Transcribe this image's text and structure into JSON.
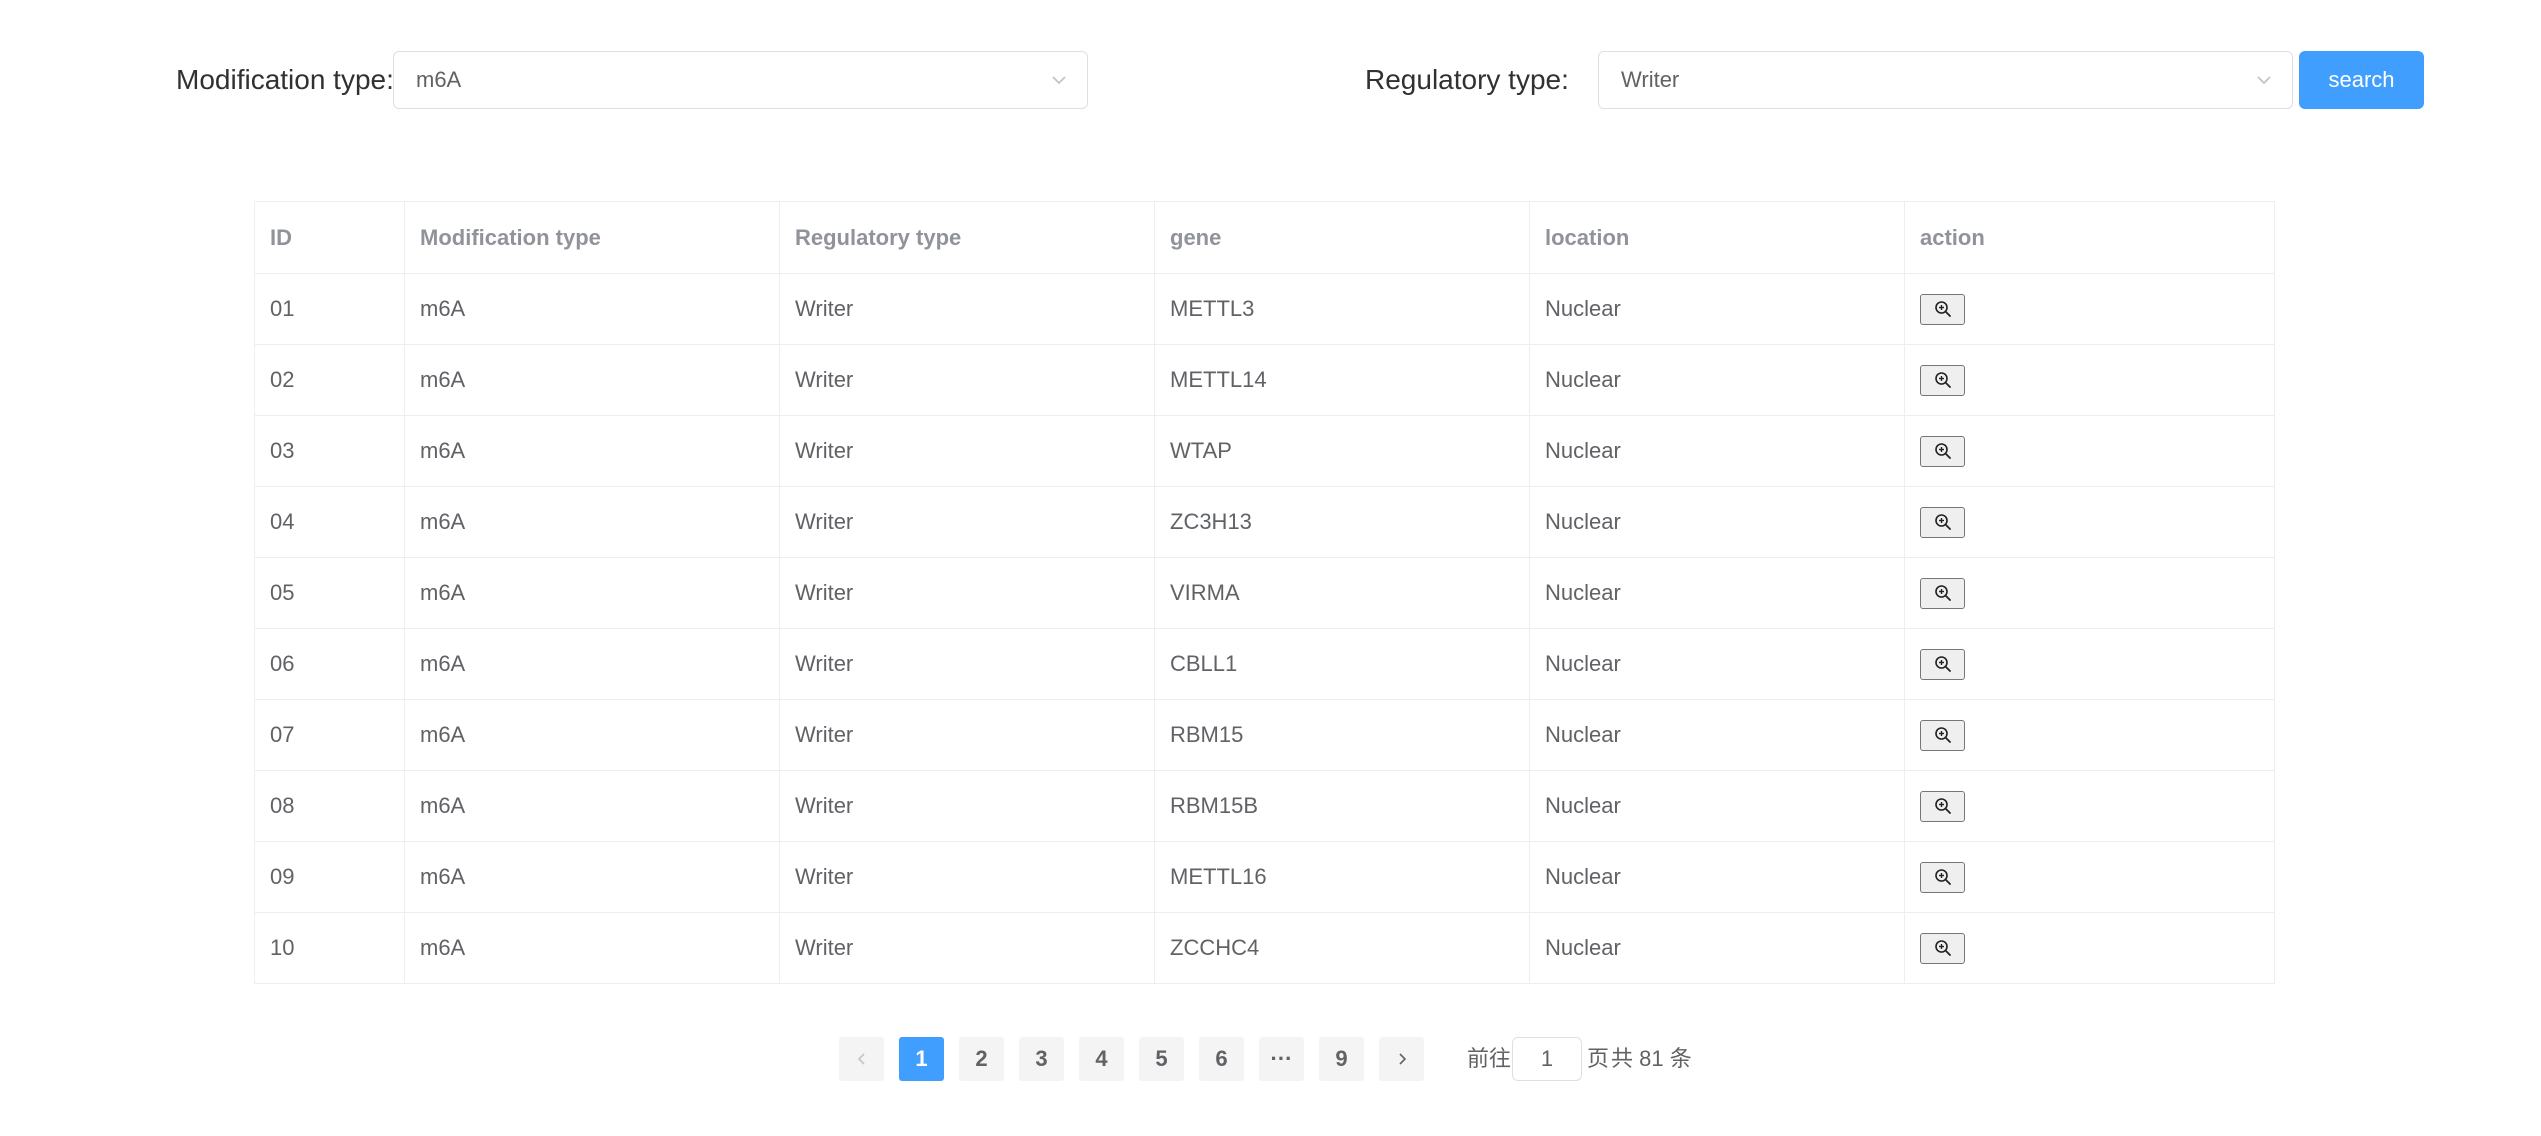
{
  "filters": {
    "modification_label": "Modification type:",
    "modification_value": "m6A",
    "regulatory_label": "Regulatory type:",
    "regulatory_value": "Writer",
    "search_label": "search"
  },
  "table": {
    "headers": [
      "ID",
      "Modification type",
      "Regulatory type",
      "gene",
      "location",
      "action"
    ],
    "rows": [
      {
        "id": "01",
        "mod": "m6A",
        "reg": "Writer",
        "gene": "METTL3",
        "location": "Nuclear"
      },
      {
        "id": "02",
        "mod": "m6A",
        "reg": "Writer",
        "gene": "METTL14",
        "location": "Nuclear"
      },
      {
        "id": "03",
        "mod": "m6A",
        "reg": "Writer",
        "gene": "WTAP",
        "location": "Nuclear"
      },
      {
        "id": "04",
        "mod": "m6A",
        "reg": "Writer",
        "gene": "ZC3H13",
        "location": "Nuclear"
      },
      {
        "id": "05",
        "mod": "m6A",
        "reg": "Writer",
        "gene": "VIRMA",
        "location": "Nuclear"
      },
      {
        "id": "06",
        "mod": "m6A",
        "reg": "Writer",
        "gene": "CBLL1",
        "location": "Nuclear"
      },
      {
        "id": "07",
        "mod": "m6A",
        "reg": "Writer",
        "gene": "RBM15",
        "location": "Nuclear"
      },
      {
        "id": "08",
        "mod": "m6A",
        "reg": "Writer",
        "gene": "RBM15B",
        "location": "Nuclear"
      },
      {
        "id": "09",
        "mod": "m6A",
        "reg": "Writer",
        "gene": "METTL16",
        "location": "Nuclear"
      },
      {
        "id": "10",
        "mod": "m6A",
        "reg": "Writer",
        "gene": "ZCCHC4",
        "location": "Nuclear"
      }
    ],
    "action_icon": "zoom-in-icon"
  },
  "pagination": {
    "pages": [
      "1",
      "2",
      "3",
      "4",
      "5",
      "6",
      "···",
      "9"
    ],
    "current": "1",
    "goto_prefix": "前往",
    "goto_value": "1",
    "goto_suffix": "页",
    "total_text": "共 81 条"
  },
  "colors": {
    "accent": "#409eff",
    "border": "#ebeef5",
    "header_text": "#909399",
    "body_text": "#606266"
  }
}
